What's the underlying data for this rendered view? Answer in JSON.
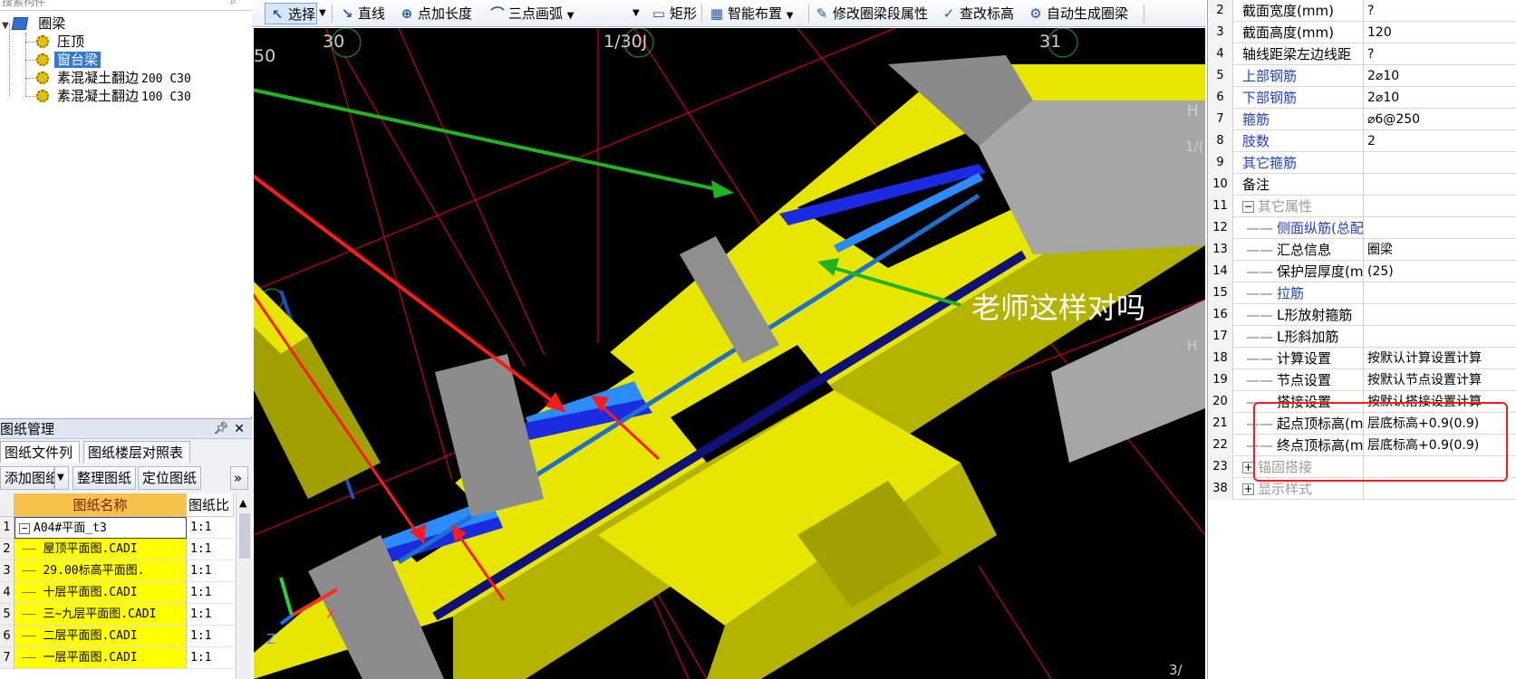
{
  "tree": {
    "search_placeholder": "搜索构件",
    "root_label": "圈梁",
    "items": [
      {
        "label": "压顶",
        "col": ""
      },
      {
        "label": "窗台梁",
        "col": ""
      },
      {
        "label": "素混凝土翻边",
        "col": "200 C30"
      },
      {
        "label": "素混凝土翻边",
        "col": "100 C30"
      }
    ]
  },
  "drawing_manager": {
    "title": "图纸管理",
    "tabs": [
      "图纸文件列表",
      "图纸楼层对照表"
    ],
    "buttons": [
      "添加图纸",
      "整理图纸",
      "定位图纸"
    ],
    "more": "»",
    "headers": {
      "name": "图纸名称",
      "ratio": "图纸比"
    },
    "rows": [
      {
        "num": "1",
        "name": "A04#平面_t3",
        "ratio": "1:1",
        "expander": "−"
      },
      {
        "num": "2",
        "name": "屋顶平面图.CADI",
        "ratio": "1:1"
      },
      {
        "num": "3",
        "name": "29.00标高平面图.",
        "ratio": "1:1"
      },
      {
        "num": "4",
        "name": "十层平面图.CADI",
        "ratio": "1:1"
      },
      {
        "num": "5",
        "name": "三~九层平面图.CADI",
        "ratio": "1:1"
      },
      {
        "num": "6",
        "name": "二层平面图.CADI",
        "ratio": "1:1"
      },
      {
        "num": "7",
        "name": "一层平面图.CADI",
        "ratio": "1:1"
      }
    ]
  },
  "toolbar": {
    "select": "选择",
    "line": "直线",
    "point_length": "点加长度",
    "arc": "三点画弧",
    "rect": "矩形",
    "smart": "智能布置",
    "modify": "修改圈梁段属性",
    "check_elev": "查改标高",
    "auto_gen": "自动生成圈梁"
  },
  "viewport": {
    "axis_labels": [
      "30",
      "1/30J",
      "31",
      "50",
      "H",
      "1/(",
      "H"
    ],
    "annotation": "老师这样对吗",
    "axis_x": "X",
    "axis_z": "Z",
    "corner_text": "3/"
  },
  "colors": {
    "accent_red": "#ff1a1a",
    "arrow_green": "#22b322",
    "beam_yellow": "#e8e800",
    "selection_blue": "#3179d4",
    "rebar_blue": "#1a3cff"
  },
  "properties": [
    {
      "num": "2",
      "key": "截面宽度(mm)",
      "value": "?",
      "style": ""
    },
    {
      "num": "3",
      "key": "截面高度(mm)",
      "value": "120",
      "style": ""
    },
    {
      "num": "4",
      "key": "轴线距梁左边线距",
      "value": "?",
      "style": ""
    },
    {
      "num": "5",
      "key": "上部钢筋",
      "value": "2⌀10",
      "style": "blue"
    },
    {
      "num": "6",
      "key": "下部钢筋",
      "value": "2⌀10",
      "style": "blue"
    },
    {
      "num": "7",
      "key": "箍筋",
      "value": "⌀6@250",
      "style": "blue"
    },
    {
      "num": "8",
      "key": "肢数",
      "value": "2",
      "style": "blue"
    },
    {
      "num": "9",
      "key": "其它箍筋",
      "value": "",
      "style": "blue"
    },
    {
      "num": "10",
      "key": "备注",
      "value": "",
      "style": ""
    },
    {
      "num": "11",
      "key": "其它属性",
      "value": "",
      "style": "gray",
      "expander": "−"
    },
    {
      "num": "12",
      "key": "侧面纵筋(总配",
      "value": "",
      "style": "blue",
      "indent": true
    },
    {
      "num": "13",
      "key": "汇总信息",
      "value": "圈梁",
      "style": "",
      "indent": true
    },
    {
      "num": "14",
      "key": "保护层厚度(mm)",
      "value": "(25)",
      "style": "",
      "indent": true
    },
    {
      "num": "15",
      "key": "拉筋",
      "value": "",
      "style": "blue",
      "indent": true
    },
    {
      "num": "16",
      "key": "L形放射箍筋",
      "value": "",
      "style": "",
      "indent": true
    },
    {
      "num": "17",
      "key": "L形斜加筋",
      "value": "",
      "style": "",
      "indent": true
    },
    {
      "num": "18",
      "key": "计算设置",
      "value": "按默认计算设置计算",
      "style": "",
      "indent": true
    },
    {
      "num": "19",
      "key": "节点设置",
      "value": "按默认节点设置计算",
      "style": "",
      "indent": true
    },
    {
      "num": "20",
      "key": "搭接设置",
      "value": "按默认搭接设置计算",
      "style": "",
      "indent": true
    },
    {
      "num": "21",
      "key": "起点顶标高(m)",
      "value": "层底标高+0.9(0.9)",
      "style": "",
      "indent": true
    },
    {
      "num": "22",
      "key": "终点顶标高(m)",
      "value": "层底标高+0.9(0.9)",
      "style": "",
      "indent": true
    },
    {
      "num": "23",
      "key": "锚固搭接",
      "value": "",
      "style": "gray",
      "expander": "+"
    },
    {
      "num": "38",
      "key": "显示样式",
      "value": "",
      "style": "gray",
      "expander": "+"
    }
  ]
}
